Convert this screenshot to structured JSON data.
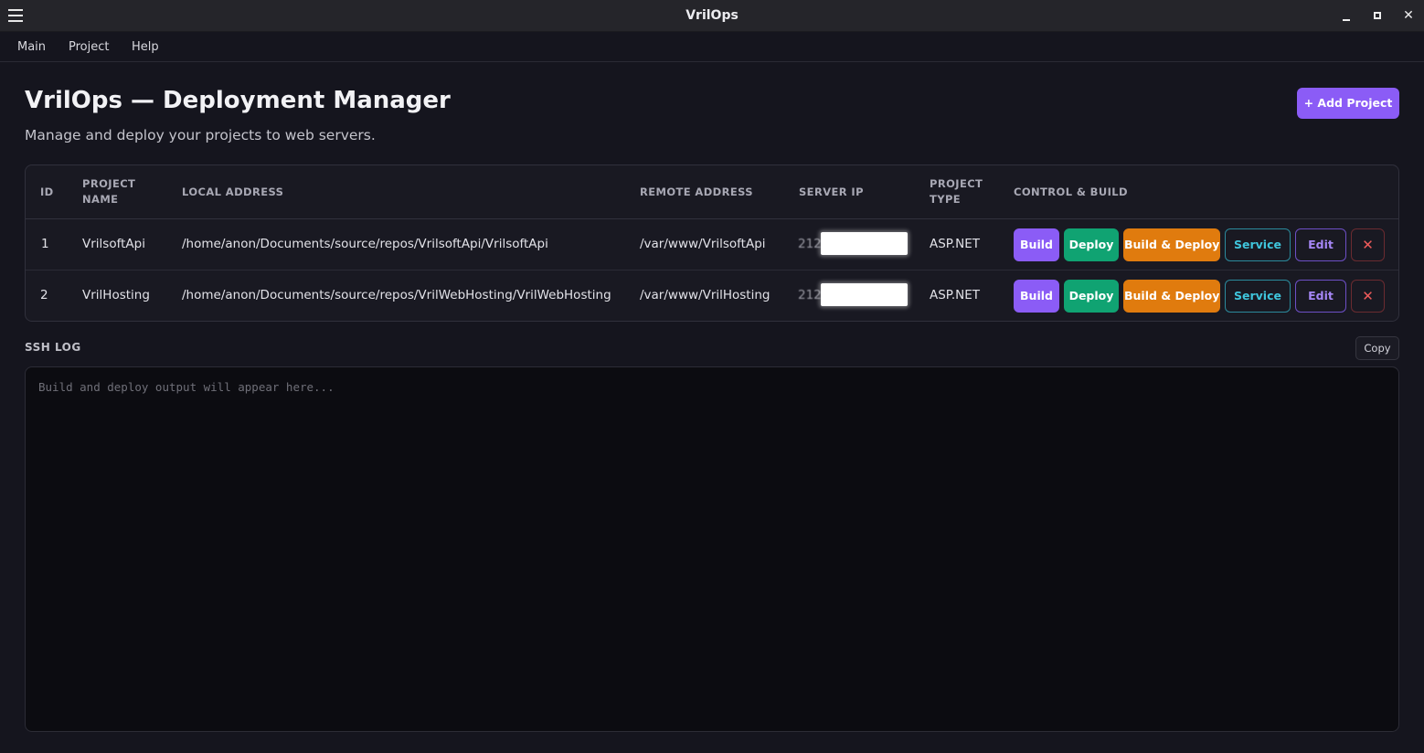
{
  "window": {
    "title": "VrilOps",
    "close_glyph": "✕",
    "icons": [
      "hamburger-menu-icon",
      "minimize-icon",
      "maximize-icon",
      "close-icon"
    ]
  },
  "menubar": {
    "items": [
      "Main",
      "Project",
      "Help"
    ]
  },
  "header": {
    "title": "VrilOps — Deployment Manager",
    "subtitle": "Manage and deploy your projects to web servers.",
    "add_button": "+ Add Project"
  },
  "table": {
    "columns": {
      "id": "ID",
      "project_name_1": "PROJECT",
      "project_name_2": "NAME",
      "local_address": "LOCAL ADDRESS",
      "remote_address": "REMOTE ADDRESS",
      "server_ip": "SERVER IP",
      "project_type_1": "PROJECT",
      "project_type_2": "TYPE",
      "control": "CONTROL & BUILD"
    },
    "rows": [
      {
        "id": "1",
        "name": "VrilsoftApi",
        "local": "/home/anon/Documents/source/repos/VrilsoftApi/VrilsoftApi",
        "remote": "/var/www/VrilsoftApi",
        "ip_visible": "212",
        "type": "ASP.NET"
      },
      {
        "id": "2",
        "name": "VrilHosting",
        "local": "/home/anon/Documents/source/repos/VrilWebHosting/VrilWebHosting",
        "remote": "/var/www/VrilHosting",
        "ip_visible": "212",
        "type": "ASP.NET"
      }
    ],
    "actions": {
      "build": "Build",
      "deploy": "Deploy",
      "build_deploy": "Build & Deploy",
      "service": "Service",
      "edit": "Edit",
      "delete": "✕"
    }
  },
  "log": {
    "label": "SSH LOG",
    "copy": "Copy",
    "placeholder": "Build and deploy output will appear here..."
  },
  "colors": {
    "accent_purple": "#8b5cf6",
    "deploy_green": "#10a372",
    "build_deploy_orange": "#e07b0e",
    "service_cyan": "#3fc5dc",
    "delete_red": "#ef5b5b",
    "background": "#15151e"
  }
}
